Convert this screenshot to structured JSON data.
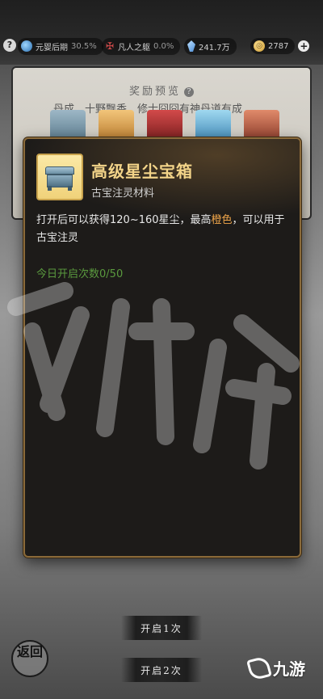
{
  "status_bar": {
    "realm": "元婴后期",
    "realm_percent": "30.5%",
    "mortal_label": "凡人之躯",
    "mortal_percent": "0.0%",
    "spirit_stones": "241.7万",
    "coins": "2787"
  },
  "reward_panel": {
    "title": "奖励预览",
    "subtitle": "丹成，十野飘香，修士囧囧有神丹道有成"
  },
  "item": {
    "name": "高级星尘宝箱",
    "category": "古宝注灵材料",
    "desc_before": "打开后可以获得120~160星尘，最高",
    "desc_highlight": "橙色",
    "desc_after": "，可以用于古宝注灵",
    "daily_label": "今日开启次数",
    "daily_value": "0/50"
  },
  "buttons": {
    "open_once": "开启1次",
    "open_twice": "开启2次",
    "back": "返回"
  },
  "logo_text": "九游",
  "colors": {
    "item_name": "#f3d489",
    "highlight": "#f0a64a",
    "daily": "#5a9a3e",
    "popup_border": "#8a6a3a"
  }
}
